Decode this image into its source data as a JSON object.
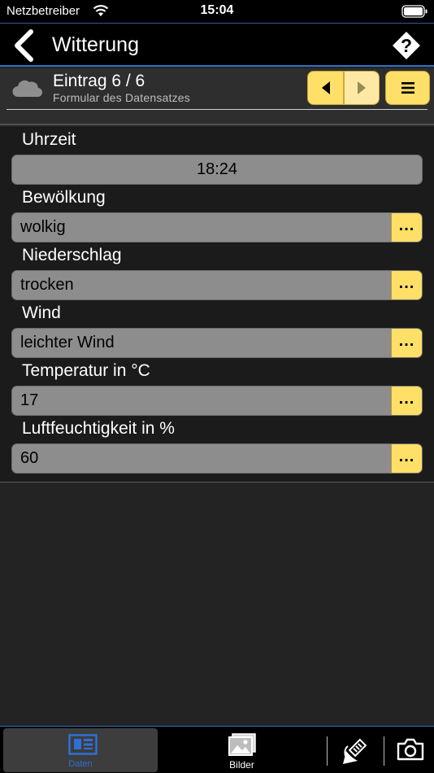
{
  "status_bar": {
    "carrier": "Netzbetreiber",
    "time": "15:04"
  },
  "nav": {
    "title": "Witterung"
  },
  "record": {
    "title": "Eintrag 6 / 6",
    "subtitle": "Formular des Datensatzes"
  },
  "fields": [
    {
      "label": "Uhrzeit",
      "value": "18:24"
    },
    {
      "label": "Bewölkung",
      "value": "wolkig"
    },
    {
      "label": "Niederschlag",
      "value": "trocken"
    },
    {
      "label": "Wind",
      "value": "leichter Wind"
    },
    {
      "label": "Temperatur in °C",
      "value": "17"
    },
    {
      "label": "Luftfeuchtigkeit in %",
      "value": "60"
    }
  ],
  "picker_label": "...",
  "tabs": {
    "form_label": "Daten",
    "images_label": "Bilder"
  },
  "colors": {
    "accent_yellow": "#fedf68",
    "accent_blue": "#2e6fc4",
    "field_gray": "#8d8d8d"
  },
  "icons": [
    "wifi-icon",
    "battery-icon",
    "back-chevron-icon",
    "help-icon",
    "cloud-icon",
    "arrow-left-icon",
    "arrow-right-icon",
    "menu-icon",
    "form-icon",
    "images-icon",
    "satellite-icon",
    "camera-icon"
  ]
}
